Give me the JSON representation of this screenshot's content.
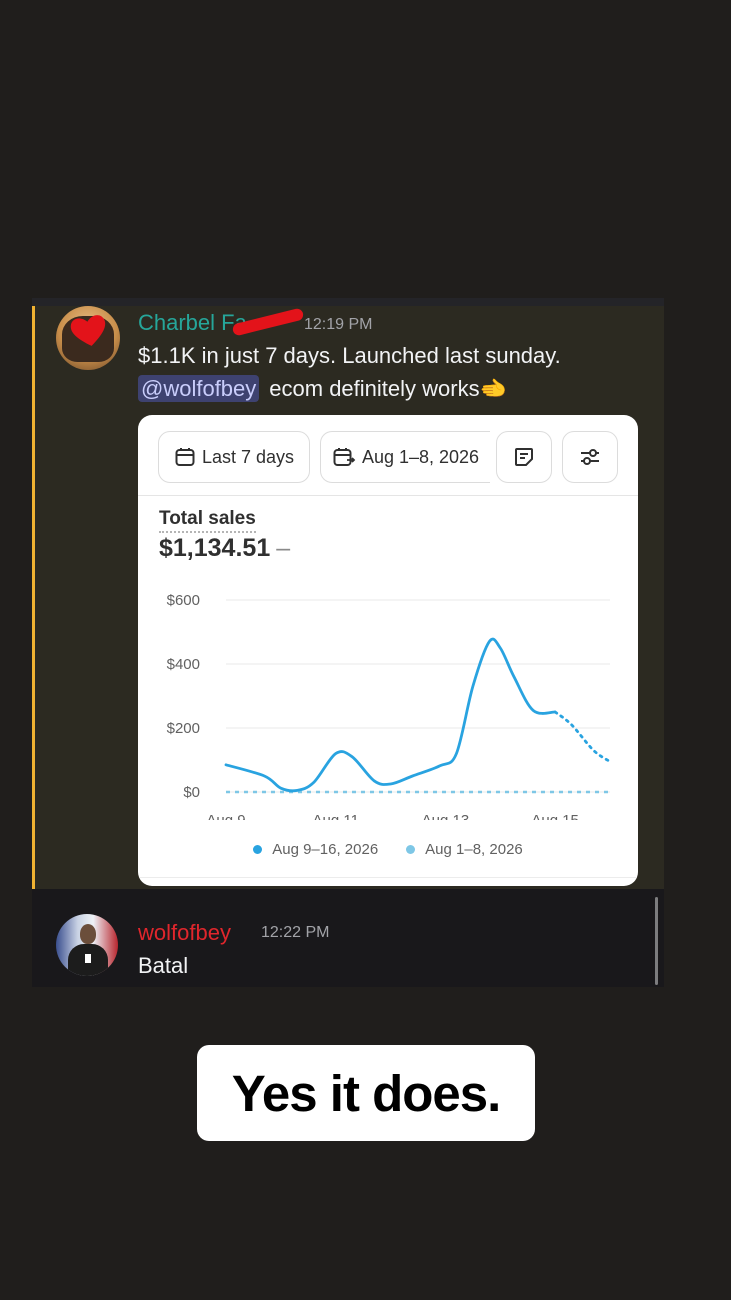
{
  "message1": {
    "username": "Charbel Fa",
    "timestamp": "12:19 PM",
    "line1": "$1.1K in just 7 days. Launched last sunday.",
    "mention": "@wolfofbey",
    "line2_text": "ecom definitely works",
    "emoji": "🫲",
    "mention_bar_color": "#f0b232",
    "username_color": "#26a69a",
    "card": {
      "date_range_label": "Last 7 days",
      "compare_label": "Aug 1–8, 2026",
      "icons": [
        "calendar-icon",
        "calendar-compare-icon",
        "note-icon",
        "sliders-icon"
      ],
      "metric_label": "Total sales",
      "metric_value": "$1,134.51",
      "metric_change": "–"
    }
  },
  "chart_data": {
    "type": "line",
    "title": "",
    "xlabel": "",
    "ylabel": "",
    "ylim": [
      0,
      600
    ],
    "y_ticks": [
      "$600",
      "$400",
      "$200",
      "$0"
    ],
    "y_tick_values": [
      600,
      400,
      200,
      0
    ],
    "x_tick_labels": [
      "Aug 9",
      "Aug 11",
      "Aug 13",
      "Aug 15"
    ],
    "x_tick_indices": [
      0,
      2,
      4,
      6
    ],
    "grid": true,
    "legend_position": "bottom",
    "series": [
      {
        "name": "Aug 9–16, 2026",
        "color": "#29a3e0",
        "x": [
          0,
          0.7,
          1,
          1.3,
          1.6,
          2,
          2.3,
          2.7,
          3,
          3.4,
          3.9,
          4.2,
          4.5,
          4.8,
          5,
          5.25,
          5.6,
          6,
          6.3,
          6.7,
          7
        ],
        "values": [
          85,
          50,
          12,
          5,
          30,
          120,
          110,
          35,
          25,
          50,
          82,
          120,
          330,
          470,
          450,
          360,
          255,
          250,
          210,
          130,
          95
        ],
        "dashed_from_x": 6
      },
      {
        "name": "Aug 1–8, 2026",
        "color": "#7ec7e6",
        "x": [
          0,
          7
        ],
        "values": [
          0,
          0
        ],
        "dashed": true
      }
    ]
  },
  "message2": {
    "username": "wolfofbey",
    "timestamp": "12:22 PM",
    "text": "Batal",
    "username_color": "#e0262c"
  },
  "caption": "Yes it does."
}
